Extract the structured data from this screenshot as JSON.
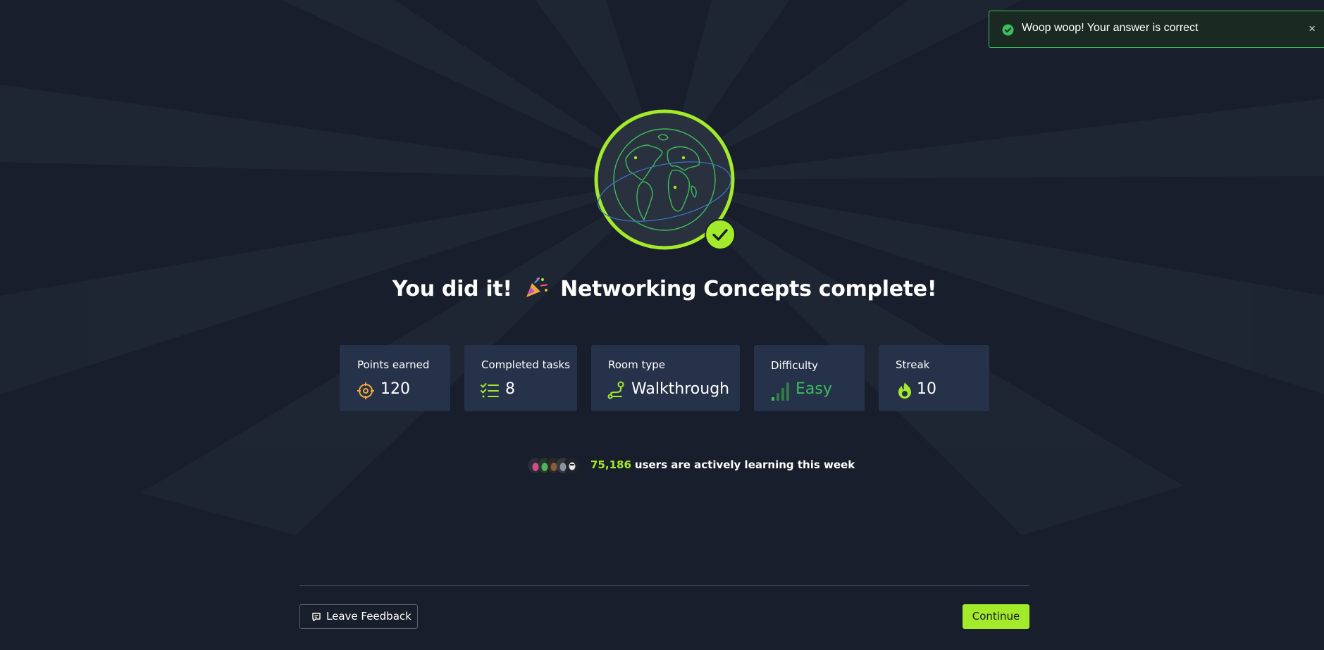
{
  "toast": {
    "message": "Woop woop! Your answer is correct",
    "close_label": "×",
    "icon": "check-circle-icon",
    "accent": "#3dbd5b"
  },
  "completion": {
    "headline_prefix": "You did it!",
    "headline_suffix": "Networking Concepts complete!",
    "badge_icon": "globe-icon",
    "check_icon": "checkmark-icon",
    "accent": "#a3ea2a"
  },
  "stats": {
    "points": {
      "label": "Points earned",
      "value": "120",
      "icon": "target-icon"
    },
    "tasks": {
      "label": "Completed tasks",
      "value": "8",
      "icon": "checklist-icon"
    },
    "room_type": {
      "label": "Room type",
      "value": "Walkthrough",
      "icon": "route-icon"
    },
    "difficulty": {
      "label": "Difficulty",
      "value": "Easy",
      "icon": "signal-bars-icon",
      "color": "#3dbd5b"
    },
    "streak": {
      "label": "Streak",
      "value": "10",
      "icon": "flame-icon"
    }
  },
  "active_users": {
    "count": "75,186",
    "text": "users are actively learning this week"
  },
  "footer": {
    "feedback_label": "Leave Feedback",
    "continue_label": "Continue"
  }
}
